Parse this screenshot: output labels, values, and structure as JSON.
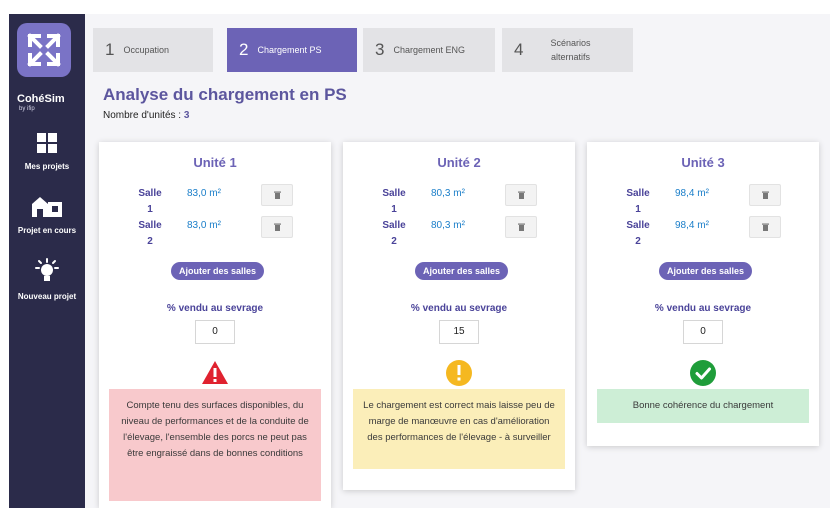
{
  "app": {
    "name": "CohéSim",
    "sub": "by ifip"
  },
  "sidebar": {
    "items": [
      {
        "label": "Mes projets",
        "icon": "grid-icon"
      },
      {
        "label": "Projet en cours",
        "icon": "barn-icon"
      },
      {
        "label": "Nouveau projet",
        "icon": "lightbulb-icon"
      }
    ]
  },
  "tabs": [
    {
      "num": "1",
      "label": "Occupation"
    },
    {
      "num": "2",
      "label": "Chargement PS"
    },
    {
      "num": "3",
      "label": "Chargement ENG"
    },
    {
      "num": "4",
      "label": "Scénarios alternatifs"
    }
  ],
  "page": {
    "title": "Analyse du chargement en PS",
    "unit_count_label": "Nombre d'unités :",
    "unit_count_value": "3"
  },
  "units": [
    {
      "title": "Unité 1",
      "rooms": [
        {
          "name": "Salle 1",
          "area": "83,0 m²"
        },
        {
          "name": "Salle 2",
          "area": "83,0 m²"
        }
      ],
      "add_label": "Ajouter des salles",
      "pct_label": "% vendu au sevrage",
      "pct_value": "0",
      "status": "error",
      "status_color": "#e0222f",
      "message": "Compte tenu des surfaces disponibles, du niveau de performances et de la conduite de l'élevage, l'ensemble des porcs ne peut pas être engraissé dans de bonnes conditions"
    },
    {
      "title": "Unité 2",
      "rooms": [
        {
          "name": "Salle 1",
          "area": "80,3 m²"
        },
        {
          "name": "Salle 2",
          "area": "80,3 m²"
        }
      ],
      "add_label": "Ajouter des salles",
      "pct_label": "% vendu au sevrage",
      "pct_value": "15",
      "status": "warning",
      "status_color": "#f5b820",
      "message": "Le chargement est correct mais laisse peu de marge de manœuvre en cas d'amélioration des performances de l'élevage - à surveiller"
    },
    {
      "title": "Unité 3",
      "rooms": [
        {
          "name": "Salle 1",
          "area": "98,4 m²"
        },
        {
          "name": "Salle 2",
          "area": "98,4 m²"
        }
      ],
      "add_label": "Ajouter des salles",
      "pct_label": "% vendu au sevrage",
      "pct_value": "0",
      "status": "ok",
      "status_color": "#1f9d3a",
      "message": "Bonne cohérence du chargement"
    }
  ]
}
